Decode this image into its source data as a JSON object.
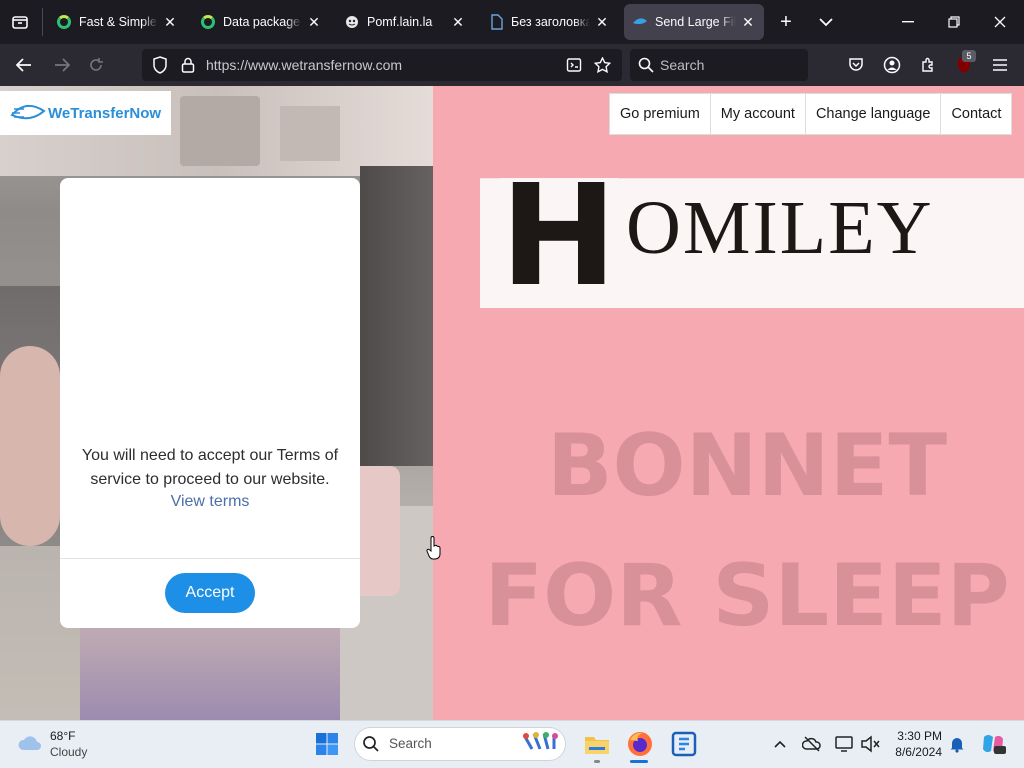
{
  "tabs": [
    {
      "title": "Fast & Simple Fi",
      "favicon": "green-ring-icon",
      "active": false
    },
    {
      "title": "Data package fr",
      "favicon": "green-ring-icon",
      "active": false
    },
    {
      "title": "Pomf.lain.la",
      "favicon": "pomf-icon",
      "active": false
    },
    {
      "title": "Без заголовка -",
      "favicon": "page-icon",
      "active": false
    },
    {
      "title": "Send Large Files",
      "favicon": "wtn-icon",
      "active": true
    }
  ],
  "navbar": {
    "url": "https://www.wetransfernow.com",
    "search_placeholder": "Search",
    "extension_badge": "5"
  },
  "page": {
    "logo_text": "WeTransferNow",
    "nav_items": [
      "Go premium",
      "My account",
      "Change language",
      "Contact"
    ],
    "ad": {
      "brand_initial": "H",
      "brand_rest": "OMILEY",
      "line1": "BONNET",
      "line2": "FOR SLEEP"
    },
    "modal": {
      "message": "You will need to accept our Terms of service to proceed to our website.",
      "link": "View terms",
      "accept": "Accept"
    }
  },
  "taskbar": {
    "weather_temp": "68°F",
    "weather_desc": "Cloudy",
    "search_placeholder": "Search",
    "time": "3:30 PM",
    "date": "8/6/2024"
  },
  "colors": {
    "accent": "#1d8fe6",
    "page_bg": "#f6a9b1",
    "brand_blue": "#2a8ed8"
  }
}
